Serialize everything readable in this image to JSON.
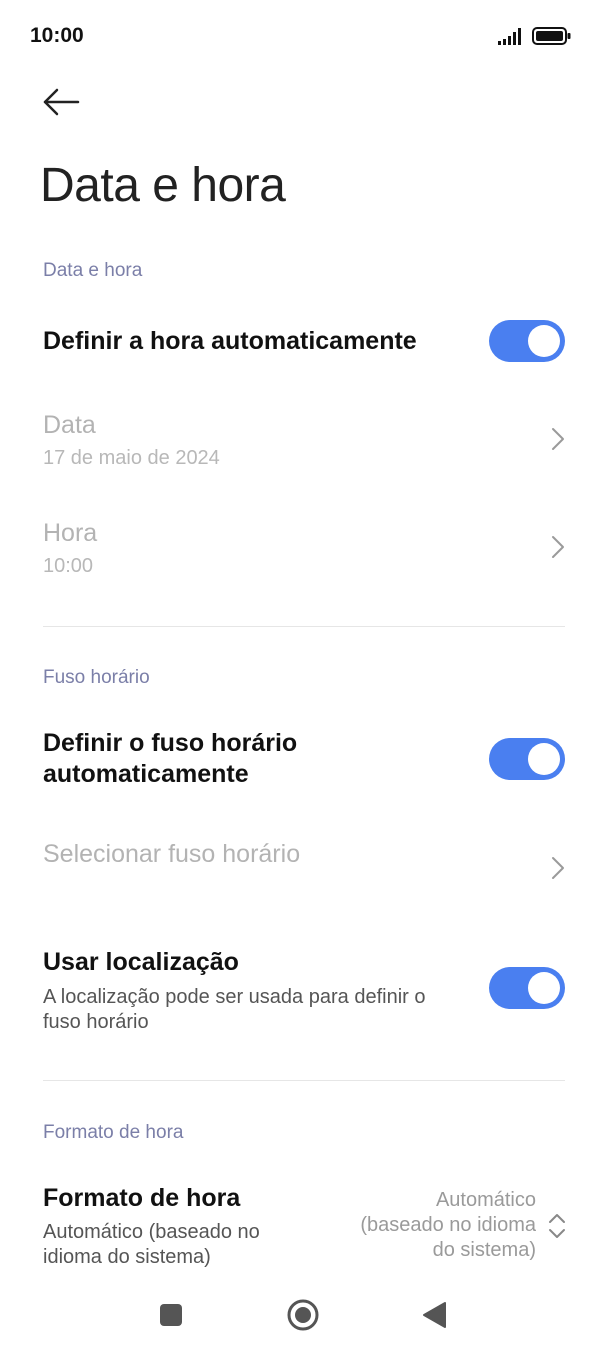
{
  "status_bar": {
    "time": "10:00"
  },
  "header": {
    "title": "Data e hora"
  },
  "sections": {
    "date_time_label": "Data e hora",
    "timezone_label": "Fuso horário",
    "format_label": "Formato de hora"
  },
  "rows": {
    "auto_time": {
      "title": "Definir a hora automaticamente",
      "enabled": true
    },
    "date": {
      "title": "Data",
      "value": "17 de maio de 2024"
    },
    "time": {
      "title": "Hora",
      "value": "10:00"
    },
    "auto_timezone": {
      "title_line1": "Definir o fuso horário",
      "title_line2": "automaticamente",
      "enabled": true
    },
    "select_timezone": {
      "title": "Selecionar fuso horário"
    },
    "use_location": {
      "title": "Usar localização",
      "sub_line1": "A localização pode ser usada para definir o",
      "sub_line2": "fuso horário",
      "enabled": true
    },
    "time_format": {
      "title": "Formato de hora",
      "sub_line1": "Automático (baseado no",
      "sub_line2": "idioma do sistema)",
      "value_line1": "Automático",
      "value_line2": "(baseado no idioma",
      "value_line3": "do sistema)"
    }
  },
  "colors": {
    "accent": "#4a7ff0",
    "section_label": "#7b7fa8",
    "disabled_text": "#b3b3b3"
  },
  "icons": {
    "back": "arrow-left-icon",
    "chevron": "chevron-right-icon",
    "updown": "chevron-up-down-icon",
    "nav_recent": "square-icon",
    "nav_home": "circle-icon",
    "nav_back": "triangle-left-icon"
  }
}
